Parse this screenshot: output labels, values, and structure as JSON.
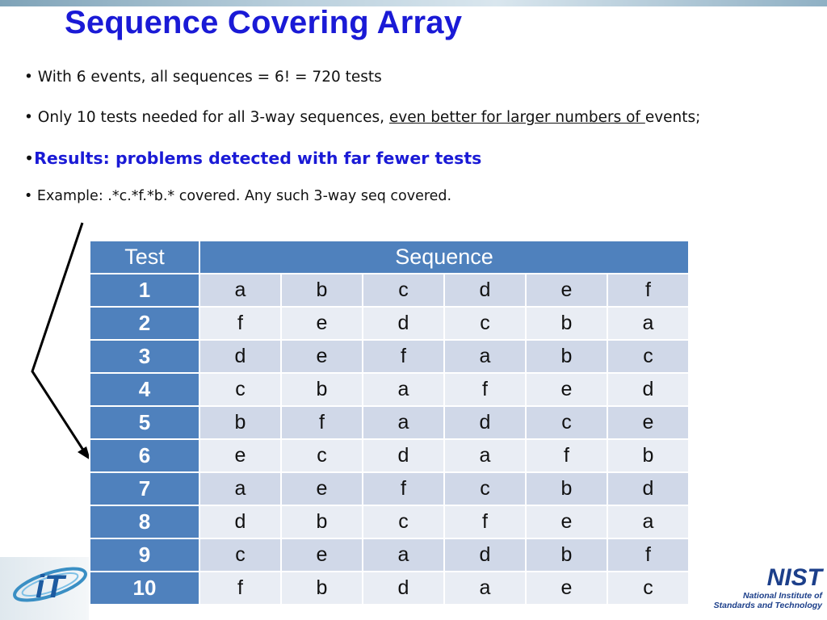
{
  "slide": {
    "title": "Sequence Covering Array",
    "bullets": [
      {
        "mark": "•",
        "text": " With 6 events, all sequences = 6! = 720 tests"
      },
      {
        "mark": "•",
        "pre": " Only 10 tests needed for all 3-way sequences, ",
        "underlined": "even better for larger numbers of ",
        "post": "events;"
      },
      {
        "mark": "•",
        "text": "Results:  problems detected with far fewer tests"
      },
      {
        "mark": "•",
        "text": " Example:  .*c.*f.*b.* covered.  Any such 3-way seq covered."
      }
    ]
  },
  "table": {
    "headers": [
      "Test",
      "Sequence"
    ],
    "rows": [
      {
        "test": "1",
        "seq": [
          "a",
          "b",
          "c",
          "d",
          "e",
          "f"
        ]
      },
      {
        "test": "2",
        "seq": [
          "f",
          "e",
          "d",
          "c",
          "b",
          "a"
        ]
      },
      {
        "test": "3",
        "seq": [
          "d",
          "e",
          "f",
          "a",
          "b",
          "c"
        ]
      },
      {
        "test": "4",
        "seq": [
          "c",
          "b",
          "a",
          "f",
          "e",
          "d"
        ]
      },
      {
        "test": "5",
        "seq": [
          "b",
          "f",
          "a",
          "d",
          "c",
          "e"
        ]
      },
      {
        "test": "6",
        "seq": [
          "e",
          "c",
          "d",
          "a",
          "f",
          "b"
        ]
      },
      {
        "test": "7",
        "seq": [
          "a",
          "e",
          "f",
          "c",
          "b",
          "d"
        ]
      },
      {
        "test": "8",
        "seq": [
          "d",
          "b",
          "c",
          "f",
          "e",
          "a"
        ]
      },
      {
        "test": "9",
        "seq": [
          "c",
          "e",
          "a",
          "d",
          "b",
          "f"
        ]
      },
      {
        "test": "10",
        "seq": [
          "f",
          "b",
          "d",
          "a",
          "e",
          "c"
        ]
      }
    ]
  },
  "logos": {
    "left_text": "iTL",
    "nist_mark": "NIST",
    "nist_line1": "National Institute of",
    "nist_line2": "Standards and Technology"
  },
  "colors": {
    "title": "#1a1ad6",
    "header_blue": "#4f81bd",
    "row_light": "#e9edf4",
    "row_dark": "#d0d8e8"
  }
}
